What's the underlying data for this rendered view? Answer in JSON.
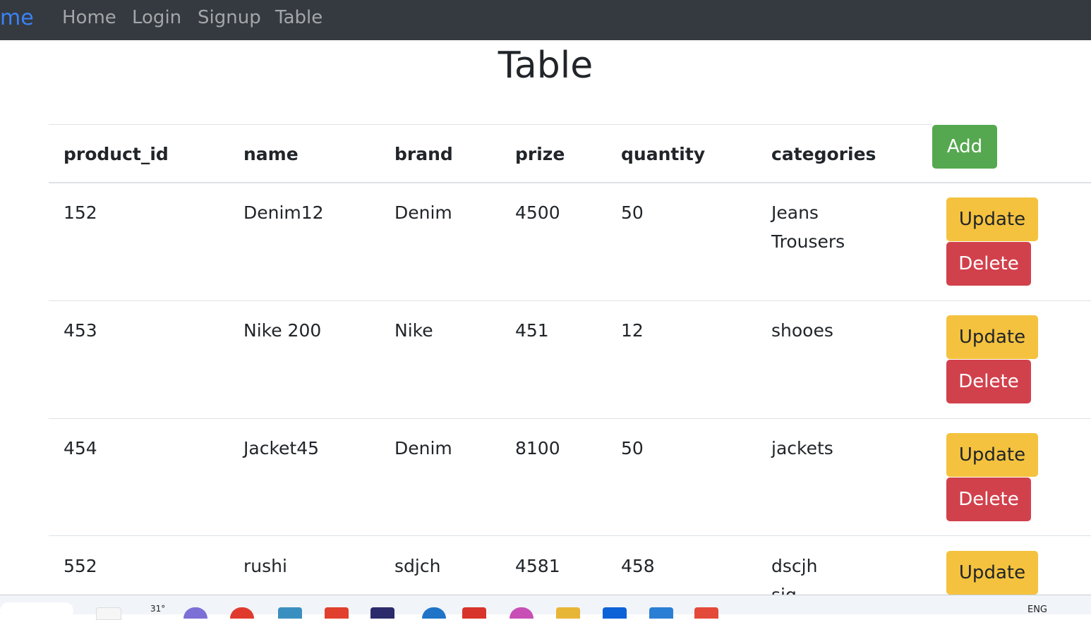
{
  "navbar": {
    "brand": "me",
    "links": [
      "Home",
      "Login",
      "Signup",
      "Table"
    ]
  },
  "page": {
    "title": "Table"
  },
  "table": {
    "columns": [
      "product_id",
      "name",
      "brand",
      "prize",
      "quantity",
      "categories"
    ],
    "add_label": "Add",
    "update_label": "Update",
    "delete_label": "Delete",
    "rows": [
      {
        "product_id": "152",
        "name": "Denim12",
        "brand": "Denim",
        "prize": "4500",
        "quantity": "50",
        "categories": [
          "Jeans",
          "Trousers"
        ]
      },
      {
        "product_id": "453",
        "name": "Nike 200",
        "brand": "Nike",
        "prize": "451",
        "quantity": "12",
        "categories": [
          "shooes"
        ]
      },
      {
        "product_id": "454",
        "name": "Jacket45",
        "brand": "Denim",
        "prize": "8100",
        "quantity": "50",
        "categories": [
          "jackets"
        ]
      },
      {
        "product_id": "552",
        "name": "rushi",
        "brand": "sdjch",
        "prize": "4581",
        "quantity": "458",
        "categories": [
          "dscjh",
          "sjg"
        ]
      }
    ]
  },
  "taskbar": {
    "weather": "31°",
    "language": "ENG",
    "icons": [
      "widgets-icon",
      "search-icon",
      "chat-icon",
      "chrome-icon",
      "app-icon",
      "store-icon",
      "security-icon",
      "browser-icon",
      "vscode-icon",
      "chrome-profile-icon",
      "paint-icon",
      "folder-icon",
      "mail-icon",
      "app-icon",
      "app-icon"
    ],
    "icon_colors": [
      "#888888",
      "#7c6fd6",
      "#e03a2f",
      "#3a8fc1",
      "#e0402d",
      "#2b2b6b",
      "#1f74c8",
      "#d8342b",
      "#c74fb6",
      "#e8b636",
      "#0e62d8",
      "#2a7fd4",
      "#e44a3a"
    ]
  }
}
